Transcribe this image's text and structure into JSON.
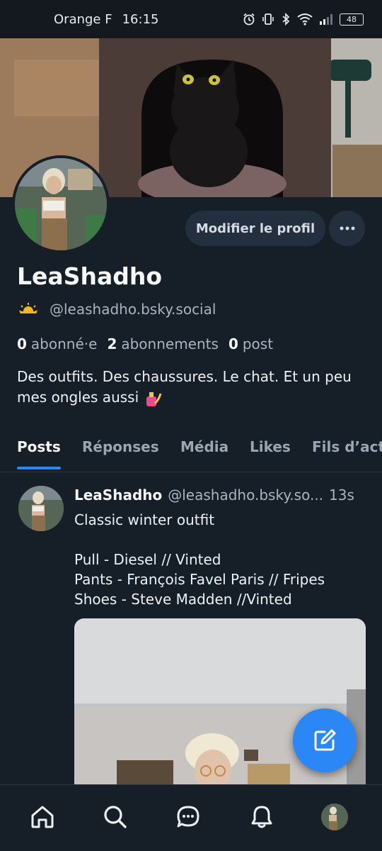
{
  "status_bar": {
    "carrier": "Orange F",
    "time": "16:15",
    "battery": "48",
    "icons": [
      "alarm-icon",
      "vibrate-icon",
      "bluetooth-icon",
      "wifi-icon",
      "signal-icon",
      "battery-icon"
    ]
  },
  "profile": {
    "display_name": "LeaShadho",
    "handle": "@leashadho.bsky.social",
    "handle_emoji": "sun-behind-cloud-icon",
    "edit_button": "Modifier le profil",
    "more_button": "more-icon",
    "stats": {
      "followers_count": "0",
      "followers_label": "abonné·e",
      "following_count": "2",
      "following_label": "abonnements",
      "posts_count": "0",
      "posts_label": "post"
    },
    "bio": "Des outfits. Des chaussures. Le chat. Et un peu mes ongles aussi",
    "bio_emoji": "nail-polish-icon"
  },
  "tabs": [
    {
      "label": "Posts",
      "active": true
    },
    {
      "label": "Réponses",
      "active": false
    },
    {
      "label": "Média",
      "active": false
    },
    {
      "label": "Likes",
      "active": false
    },
    {
      "label": "Fils d’act",
      "active": false
    }
  ],
  "post": {
    "author": "LeaShadho",
    "handle": "@leashadho.bsky.so...",
    "time": "13s",
    "text": "Classic winter outfit\n\nPull - Diesel // Vinted\nPants - François Favel Paris // Fripes\nShoes - Steve Madden //Vinted"
  },
  "fab": {
    "icon": "compose-icon"
  },
  "bottom_nav": [
    {
      "icon": "home-icon"
    },
    {
      "icon": "search-icon"
    },
    {
      "icon": "chat-icon"
    },
    {
      "icon": "bell-icon"
    },
    {
      "icon": "profile-avatar"
    }
  ],
  "colors": {
    "background": "#161e27",
    "accent": "#2a87f5",
    "button_bg": "#232e3e",
    "muted_text": "#aab4c0"
  }
}
